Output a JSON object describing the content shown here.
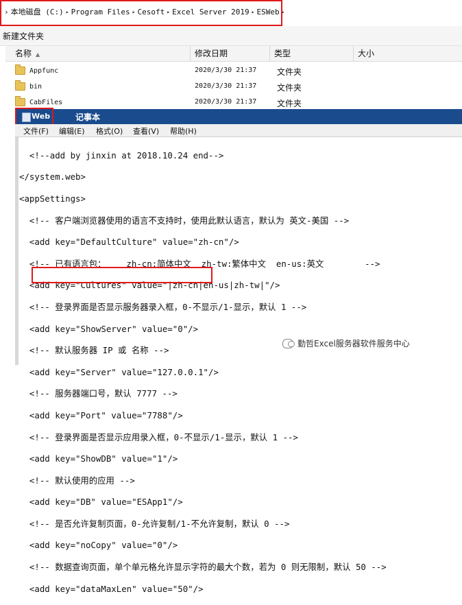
{
  "address_bar": {
    "prefix": "›",
    "crumbs": [
      "本地磁盘 (C:)",
      "Program Files",
      "Cesoft",
      "Excel Server 2019",
      "ESWeb"
    ],
    "separator": "▸"
  },
  "toolbar": {
    "new_folder": "新建文件夹"
  },
  "columns": {
    "name": "名称",
    "modified": "修改日期",
    "type": "类型",
    "size": "大小"
  },
  "rows": [
    {
      "name": "Appfunc",
      "date": "2020/3/30 21:37",
      "type": "文件夹"
    },
    {
      "name": "bin",
      "date": "2020/3/30 21:37",
      "type": "文件夹"
    },
    {
      "name": "CabFiles",
      "date": "2020/3/30 21:37",
      "type": "文件夹"
    }
  ],
  "notepad": {
    "file_name": "Web",
    "app_name": "记事本",
    "menu": [
      "文件(F)",
      "编辑(E)",
      "格式(O)",
      "查看(V)",
      "帮助(H)"
    ],
    "lines": [
      "  <!--add by jinxin at 2018.10.24 end-->",
      "</system.web>",
      "<appSettings>",
      "  <!-- 客户端浏览器使用的语言不支持时，使用此默认语言，默认为 英文-美国 -->",
      "  <add key=\"DefaultCulture\" value=\"zh-cn\"/>",
      "  <!-- 已有语言包：    zh-cn:简体中文  zh-tw:繁体中文  en-us:英文        -->",
      "  <add key=\"Cultures\" value=\"|zh-cn|en-us|zh-tw|\"/>",
      "  <!-- 登录界面是否显示服务器录入框，0-不显示/1-显示，默认 1 -->",
      "  <add key=\"ShowServer\" value=\"0\"/>",
      "  <!-- 默认服务器 IP 或 名称 -->",
      "  <add key=\"Server\" value=\"127.0.0.1\"/>",
      "  <!-- 服务器端口号，默认 7777 -->",
      "  <add key=\"Port\" value=\"7788\"/>",
      "  <!-- 登录界面是否显示应用录入框，0-不显示/1-显示，默认 1 -->",
      "  <add key=\"ShowDB\" value=\"1\"/>",
      "  <!-- 默认使用的应用 -->",
      "  <add key=\"DB\" value=\"ESApp1\"/>",
      "  <!-- 是否允许复制页面，0-允许复制/1-不允许复制，默认 0 -->",
      "  <add key=\"noCopy\" value=\"0\"/>",
      "  <!-- 数据查询页面，单个单元格允许显示字符的最大个数，若为 0 则无限制，默认 50 -->",
      "  <add key=\"dataMaxLen\" value=\"50\"/>"
    ]
  },
  "watermark": "勤哲Excel服务器软件服务中心",
  "colors": {
    "highlight": "#e0191b",
    "titlebar": "#1a4b8d"
  }
}
